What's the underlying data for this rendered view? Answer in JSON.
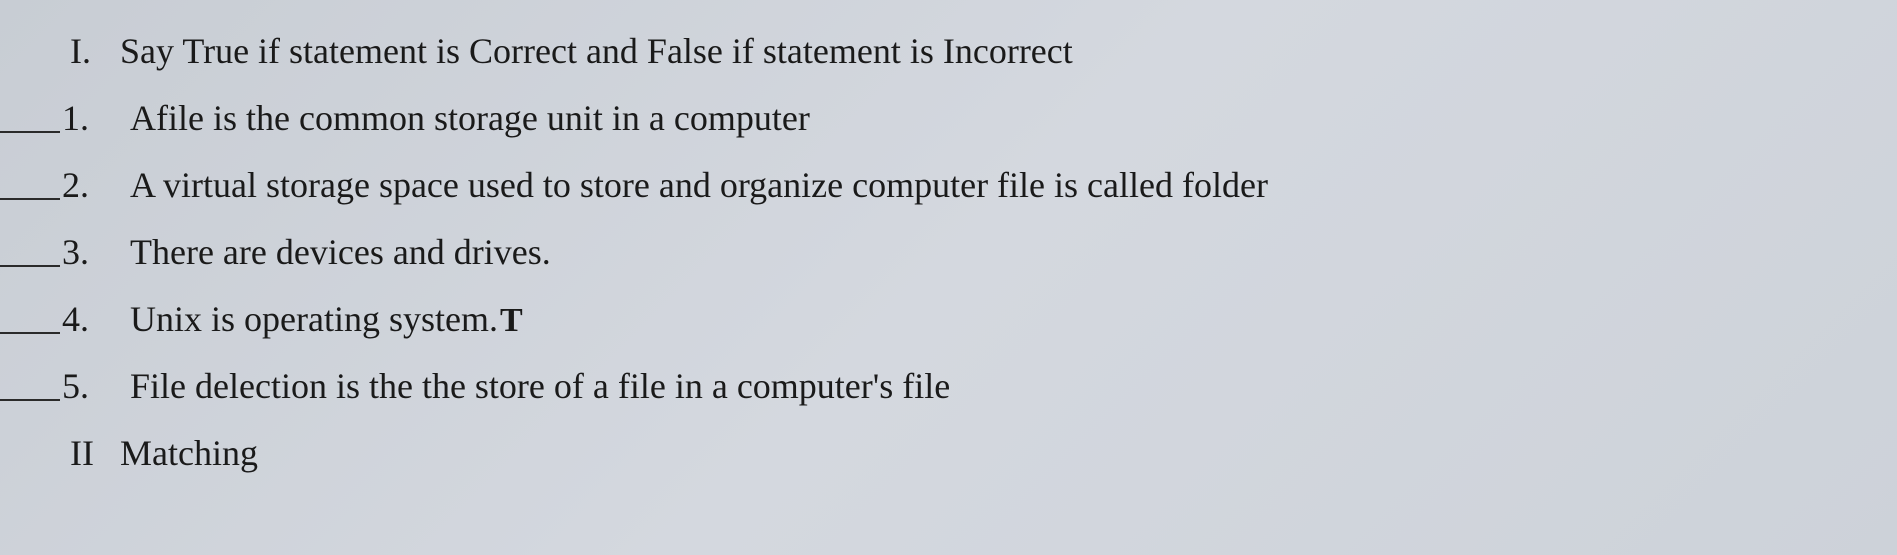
{
  "section1": {
    "roman": "I.",
    "title": "Say True if statement is Correct and False if statement is Incorrect"
  },
  "questions": [
    {
      "num": "1.",
      "text": "Afile is the common storage unit in a computer",
      "answer": ""
    },
    {
      "num": "2.",
      "text": "A virtual storage space used to store and organize computer file is called folder",
      "answer": ""
    },
    {
      "num": "3.",
      "text": "There are devices and drives.",
      "answer": ""
    },
    {
      "num": "4.",
      "text": "Unix is operating system.",
      "answer": "T"
    },
    {
      "num": "5.",
      "text": "File delection is the the store of a file in a computer's file",
      "answer": ""
    }
  ],
  "section2": {
    "roman": "II",
    "title": "Matching"
  }
}
